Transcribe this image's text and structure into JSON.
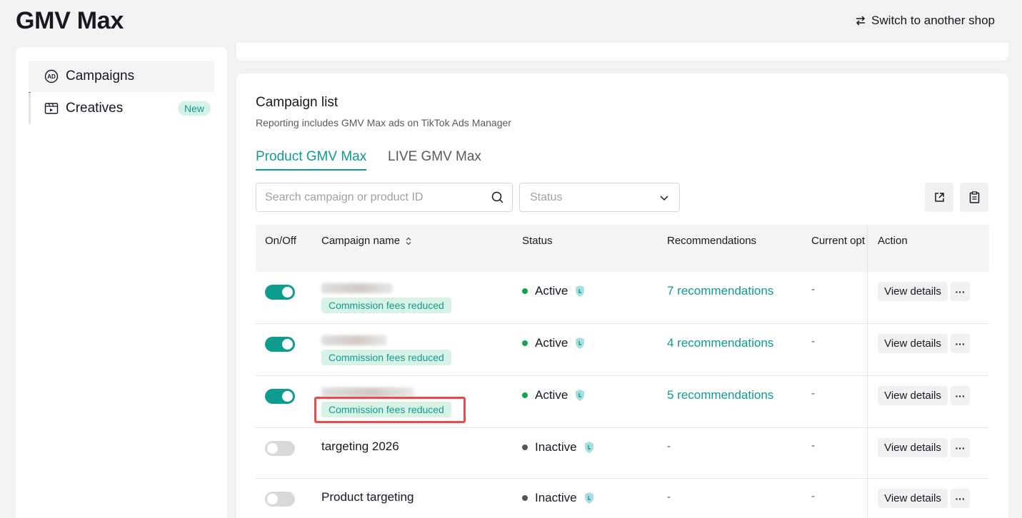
{
  "page": {
    "title": "GMV Max",
    "switch_shop": "Switch to another shop"
  },
  "sidebar": {
    "items": [
      {
        "label": "Campaigns",
        "icon": "ad-icon",
        "active": true
      },
      {
        "label": "Creatives",
        "icon": "video-icon",
        "badge": "New"
      }
    ]
  },
  "campaign_list": {
    "title": "Campaign list",
    "subtitle": "Reporting includes GMV Max ads on TikTok Ads Manager",
    "tabs": [
      {
        "label": "Product GMV Max",
        "active": true
      },
      {
        "label": "LIVE GMV Max"
      }
    ],
    "search_placeholder": "Search campaign or product ID",
    "status_placeholder": "Status",
    "columns": {
      "onoff": "On/Off",
      "name": "Campaign name",
      "status": "Status",
      "recommendations": "Recommendations",
      "current_opt": "Current opti",
      "action": "Action"
    },
    "rows": [
      {
        "name": "",
        "on": true,
        "tag": "Commission fees reduced",
        "status": "Active",
        "recommendations": "7 recommendations",
        "current": "-",
        "view": "View details",
        "more": "···"
      },
      {
        "name": "",
        "on": true,
        "tag": "Commission fees reduced",
        "status": "Active",
        "recommendations": "4 recommendations",
        "current": "-",
        "view": "View details",
        "more": "···"
      },
      {
        "name": "",
        "on": true,
        "tag": "Commission fees reduced",
        "status": "Active",
        "recommendations": "5 recommendations",
        "current": "-",
        "view": "View details",
        "more": "···",
        "highlighted": true
      },
      {
        "name": "targeting 2026",
        "on": false,
        "status": "Inactive",
        "recommendations": "-",
        "current": "-",
        "view": "View details",
        "more": "···"
      },
      {
        "name": "Product targeting",
        "on": false,
        "status": "Inactive",
        "recommendations": "-",
        "current": "-",
        "view": "View details",
        "more": "···"
      }
    ]
  },
  "colors": {
    "accent": "#0e9c8e",
    "active_dot": "#14a34b",
    "highlight": "#ec4b4b",
    "pill_bg": "#d8f3e6"
  }
}
